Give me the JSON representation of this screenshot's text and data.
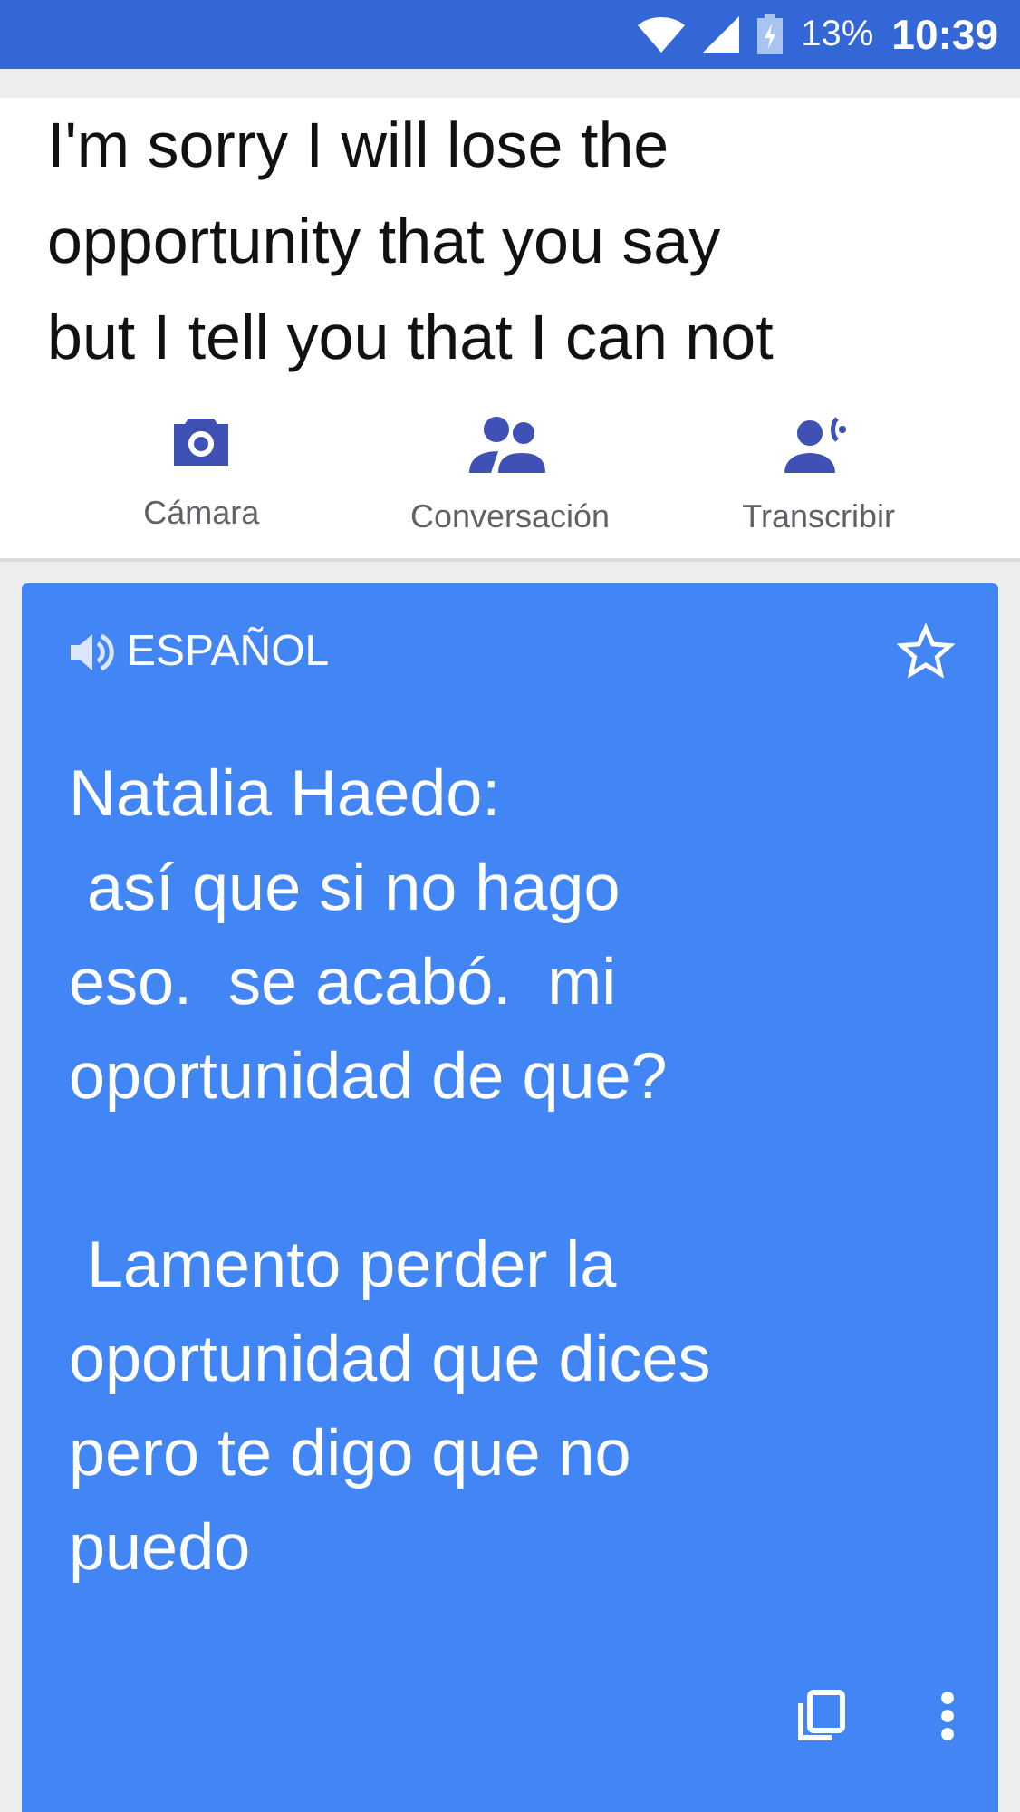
{
  "status_bar": {
    "battery": "13%",
    "time": "10:39"
  },
  "source_text": "I'm sorry I will lose the\nopportunity that you say\nbut I tell you that I can not",
  "modes": [
    {
      "label": "Cámara",
      "kind": "camera"
    },
    {
      "label": "Conversación",
      "kind": "conversation"
    },
    {
      "label": "Transcribir",
      "kind": "transcribe"
    }
  ],
  "result_card": {
    "language": "ESPAÑOL",
    "starred": false,
    "text": "Natalia Haedo:\n así que si no hago\neso.  se acabó.  mi\noportunidad de que?\n\n Lamento perder la\noportunidad que dices\npero te digo que no\npuedo"
  }
}
